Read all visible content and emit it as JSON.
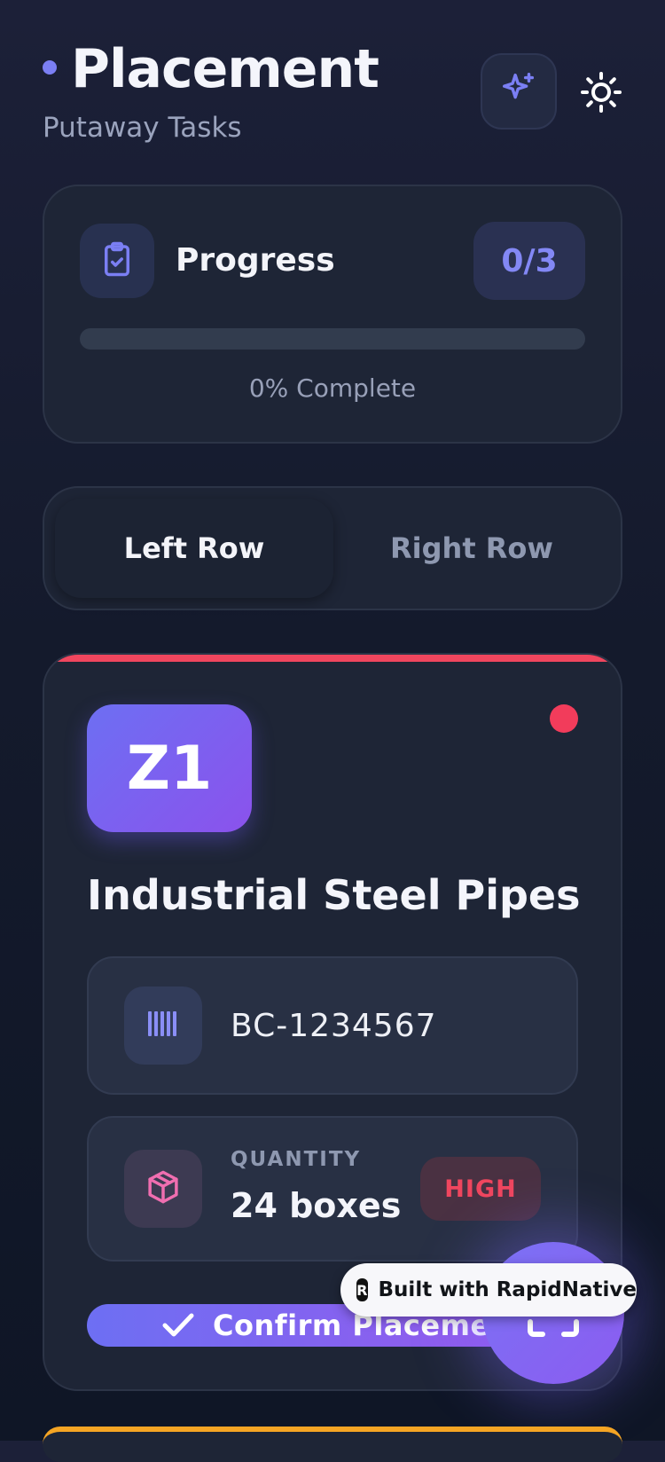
{
  "header": {
    "title": "Placement",
    "subtitle": "Putaway Tasks",
    "sparkle_icon": "sparkles-icon",
    "theme_icon": "sun-icon"
  },
  "progress": {
    "label": "Progress",
    "count": "0/3",
    "percent": 0,
    "percent_text": "0% Complete",
    "icon": "clipboard-check-icon"
  },
  "rows": {
    "left": "Left Row",
    "right": "Right Row",
    "selected": "Left Row"
  },
  "task": {
    "zone": "Z1",
    "name": "Industrial Steel Pipes",
    "barcode": "BC-1234567",
    "barcode_icon": "barcode-icon",
    "quantity_label": "QUANTITY",
    "quantity_value": "24 boxes",
    "quantity_icon": "package-icon",
    "priority": "HIGH",
    "confirm_label": "Confirm Placement"
  },
  "badge": {
    "logo": "R",
    "text": "Built with RapidNative"
  },
  "colors": {
    "accent": "#7b7ff4",
    "priority_high": "#f0465e",
    "next_card_accent": "#f5a524",
    "background": "#161c2e",
    "card": "#1e2536"
  }
}
